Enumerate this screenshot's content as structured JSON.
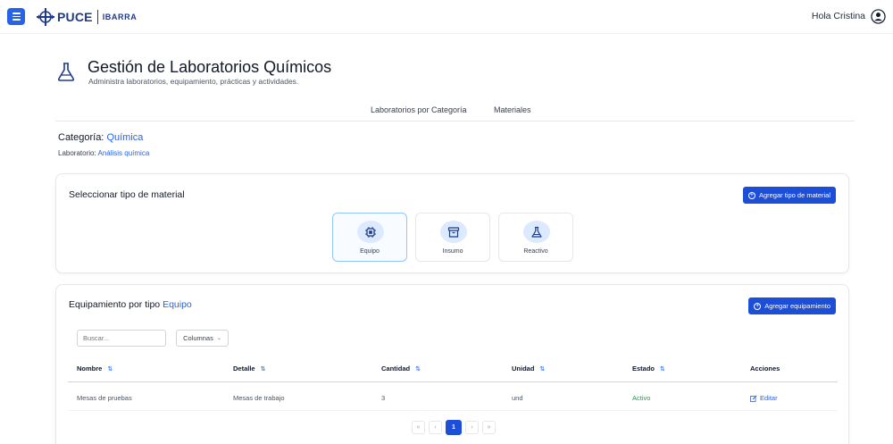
{
  "topbar": {
    "logo_main": "PUCE",
    "logo_sub": "IBARRA",
    "greeting": "Hola Cristina",
    "icons": [
      "menu-icon",
      "puce-logo",
      "user-icon"
    ]
  },
  "header": {
    "title": "Gestión de Laboratorios Químicos",
    "subtitle": "Administra laboratorios, equipamiento, prácticas y actividades.",
    "icon": "flask-icon"
  },
  "tabs": [
    {
      "label": "Laboratorios por Categoría"
    },
    {
      "label": "Materiales"
    }
  ],
  "context": {
    "category_label": "Categoría:",
    "category_value": "Química",
    "lab_label": "Laboratorio:",
    "lab_value": "Análisis química"
  },
  "material_type": {
    "title": "Seleccionar tipo de material",
    "add_button": "Agregar tipo de material",
    "options": [
      {
        "label": "Equipo",
        "icon": "chip-icon",
        "selected": true
      },
      {
        "label": "Insumo",
        "icon": "box-icon",
        "selected": false
      },
      {
        "label": "Reactivo",
        "icon": "flask-icon",
        "selected": false
      }
    ]
  },
  "equipment": {
    "title_prefix": "Equipamiento por tipo",
    "title_type": "Equipo",
    "add_button": "Agregar equipamiento",
    "search_placeholder": "Buscar...",
    "columns_button": "Columnas",
    "columns": [
      "Nombre",
      "Detalle",
      "Cantidad",
      "Unidad",
      "Estado",
      "Acciones"
    ],
    "rows": [
      {
        "nombre": "Mesas de pruebas",
        "detalle": "Mesas de trabajo",
        "cantidad": "3",
        "unidad": "und",
        "estado": "Activo",
        "accion": "Editar"
      }
    ],
    "pagination": {
      "first": "«",
      "prev": "‹",
      "current": "1",
      "next": "›",
      "last": "»"
    }
  },
  "colors": {
    "accent": "#2563eb",
    "button": "#1d4ed8",
    "status_active": "#16a34a"
  }
}
